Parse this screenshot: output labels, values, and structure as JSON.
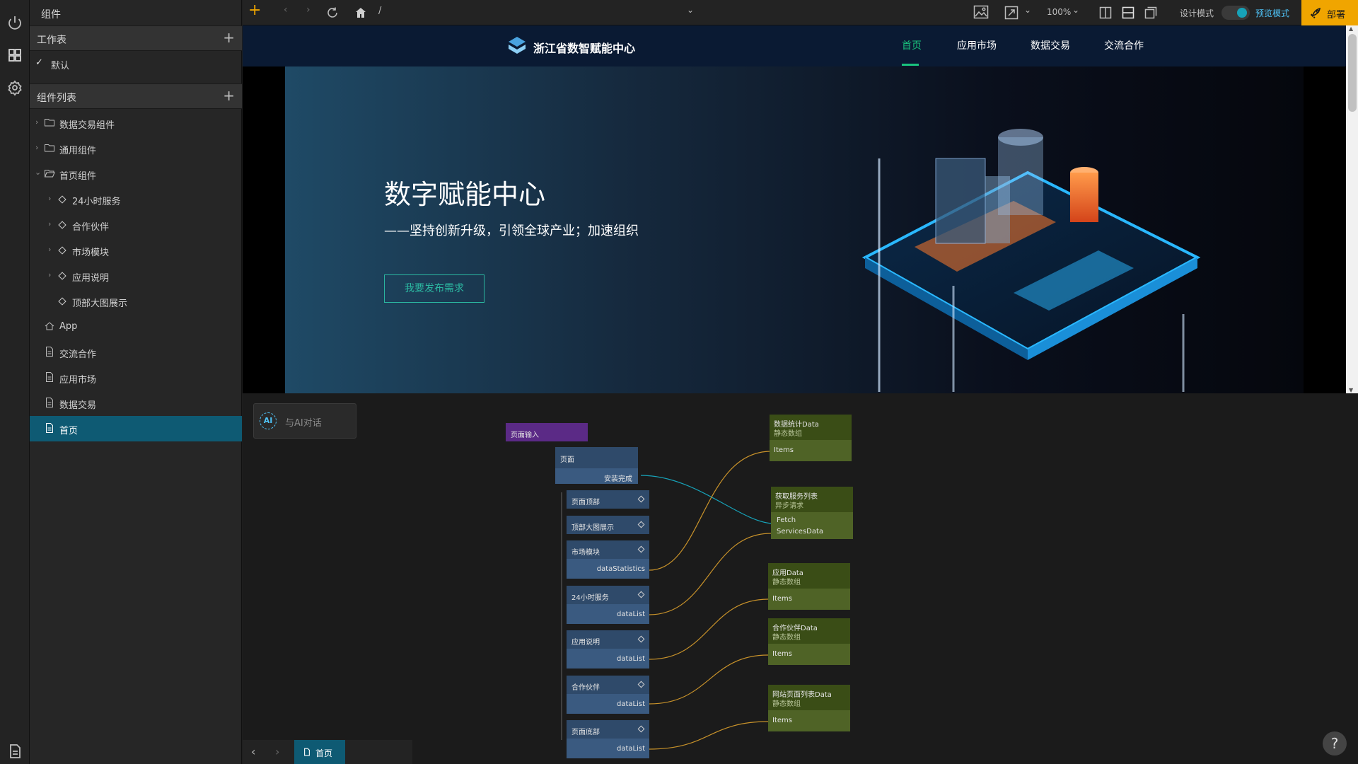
{
  "sidebar": {
    "title": "组件",
    "workspace_label": "工作表",
    "workspace_item": "默认",
    "components_label": "组件列表",
    "tree": [
      {
        "label": "数据交易组件"
      },
      {
        "label": "通用组件"
      },
      {
        "label": "首页组件"
      },
      {
        "label": "24小时服务"
      },
      {
        "label": "合作伙伴"
      },
      {
        "label": "市场模块"
      },
      {
        "label": "应用说明"
      },
      {
        "label": "顶部大图展示"
      },
      {
        "label": "App"
      },
      {
        "label": "交流合作"
      },
      {
        "label": "应用市场"
      },
      {
        "label": "数据交易"
      },
      {
        "label": "首页"
      }
    ]
  },
  "toolbar": {
    "path": "/",
    "zoom": "100%",
    "design_mode": "设计模式",
    "preview_mode": "预览模式",
    "deploy": "部署"
  },
  "site": {
    "brand": "浙江省数智赋能中心",
    "nav": [
      "首页",
      "应用市场",
      "数据交易",
      "交流合作"
    ],
    "hero_title": "数字赋能中心",
    "hero_subtitle": "——坚持创新升级，引领全球产业；加速组织",
    "hero_button": "我要发布需求"
  },
  "canvas": {
    "ai_chat": "与AI对话",
    "ai_badge": "AI",
    "page_input": "页面输入",
    "page_node": "页面",
    "page_slot": "安装完成",
    "components": [
      {
        "name": "页面顶部",
        "slot": ""
      },
      {
        "name": "顶部大图展示",
        "slot": ""
      },
      {
        "name": "市场模块",
        "slot": "dataStatistics"
      },
      {
        "name": "24小时服务",
        "slot": "dataList"
      },
      {
        "name": "应用说明",
        "slot": "dataList"
      },
      {
        "name": "合作伙伴",
        "slot": "dataList"
      },
      {
        "name": "页面底部",
        "slot": "dataList"
      }
    ],
    "data_nodes": [
      {
        "title": "数据统计Data",
        "sub": "静态数组",
        "slots": [
          "Items"
        ]
      },
      {
        "title": "获取服务列表",
        "sub": "异步请求",
        "slots": [
          "Fetch",
          "ServicesData"
        ]
      },
      {
        "title": "应用Data",
        "sub": "静态数组",
        "slots": [
          "Items"
        ]
      },
      {
        "title": "合作伙伴Data",
        "sub": "静态数组",
        "slots": [
          "Items"
        ]
      },
      {
        "title": "网站页面列表Data",
        "sub": "静态数组",
        "slots": [
          "Items"
        ]
      }
    ],
    "bottom_tab": "首页",
    "help": "?"
  },
  "colors": {
    "accent": "#0e5a73",
    "deploy": "#f0a500",
    "toggle": "#17a2b8",
    "hero_btn": "#2bb6a0",
    "nav_active": "#19c37d"
  }
}
